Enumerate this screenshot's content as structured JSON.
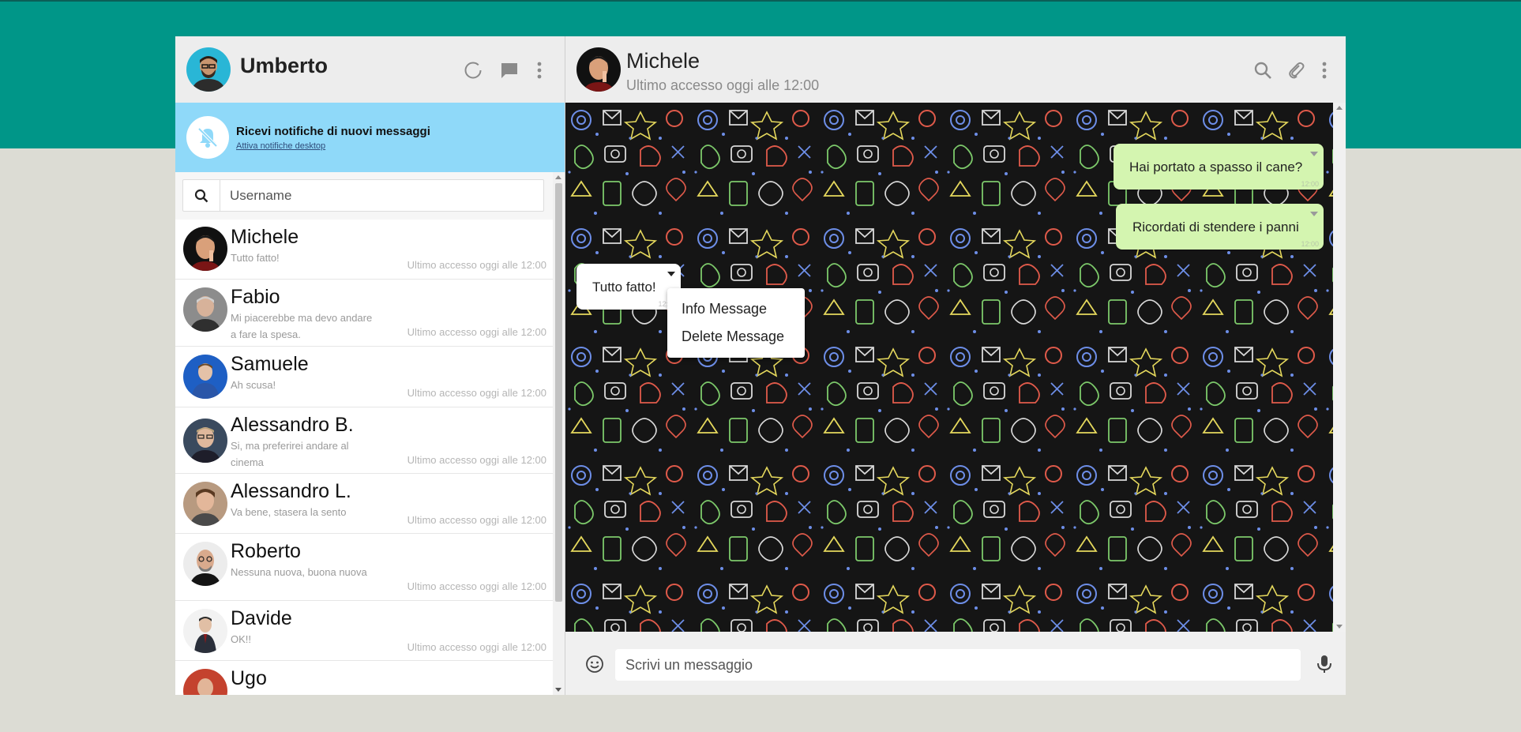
{
  "colors": {
    "top_band": "#009688",
    "sent_bubble": "#d4f5b0",
    "notification_bg": "#8fd9f9"
  },
  "me": {
    "name": "Umberto",
    "avatar_icon": "user-avatar"
  },
  "header_icons": [
    "status-icon",
    "new-chat-icon",
    "menu-dots-icon"
  ],
  "notification": {
    "title": "Ricevi notifiche di nuovi messaggi",
    "link": "Attiva notifiche desktop",
    "icon": "bell-off-icon"
  },
  "search": {
    "placeholder": "Username",
    "value": ""
  },
  "contacts": [
    {
      "name": "Michele",
      "last_message": "Tutto fatto!",
      "time": "Ultimo accesso oggi alle 12:00"
    },
    {
      "name": "Fabio",
      "last_message": "Mi piacerebbe ma devo andare a fare la spesa.",
      "time": "Ultimo accesso oggi alle 12:00"
    },
    {
      "name": "Samuele",
      "last_message": "Ah scusa!",
      "time": "Ultimo accesso oggi alle 12:00"
    },
    {
      "name": "Alessandro B.",
      "last_message": "Si, ma preferirei andare al cinema",
      "time": "Ultimo accesso oggi alle 12:00"
    },
    {
      "name": "Alessandro L.",
      "last_message": "Va bene, stasera la sento",
      "time": "Ultimo accesso oggi alle 12:00"
    },
    {
      "name": "Roberto",
      "last_message": "Nessuna nuova, buona nuova",
      "time": "Ultimo accesso oggi alle 12:00"
    },
    {
      "name": "Davide",
      "last_message": "OK!!",
      "time": "Ultimo accesso oggi alle 12:00"
    },
    {
      "name": "Ugo",
      "last_message": "",
      "time": ""
    }
  ],
  "chat": {
    "contact_name": "Michele",
    "status": "Ultimo accesso oggi alle 12:00",
    "messages": [
      {
        "text": "Hai portato a spasso il cane?",
        "time": "12:00",
        "direction": "sent"
      },
      {
        "text": "Ricordati di stendere i panni",
        "time": "12:00",
        "direction": "sent"
      },
      {
        "text": "Tutto fatto!",
        "time": "12:00",
        "direction": "received"
      }
    ],
    "context_menu": [
      "Info Message",
      "Delete Message"
    ]
  },
  "composer": {
    "placeholder": "Scrivi un messaggio",
    "value": ""
  }
}
